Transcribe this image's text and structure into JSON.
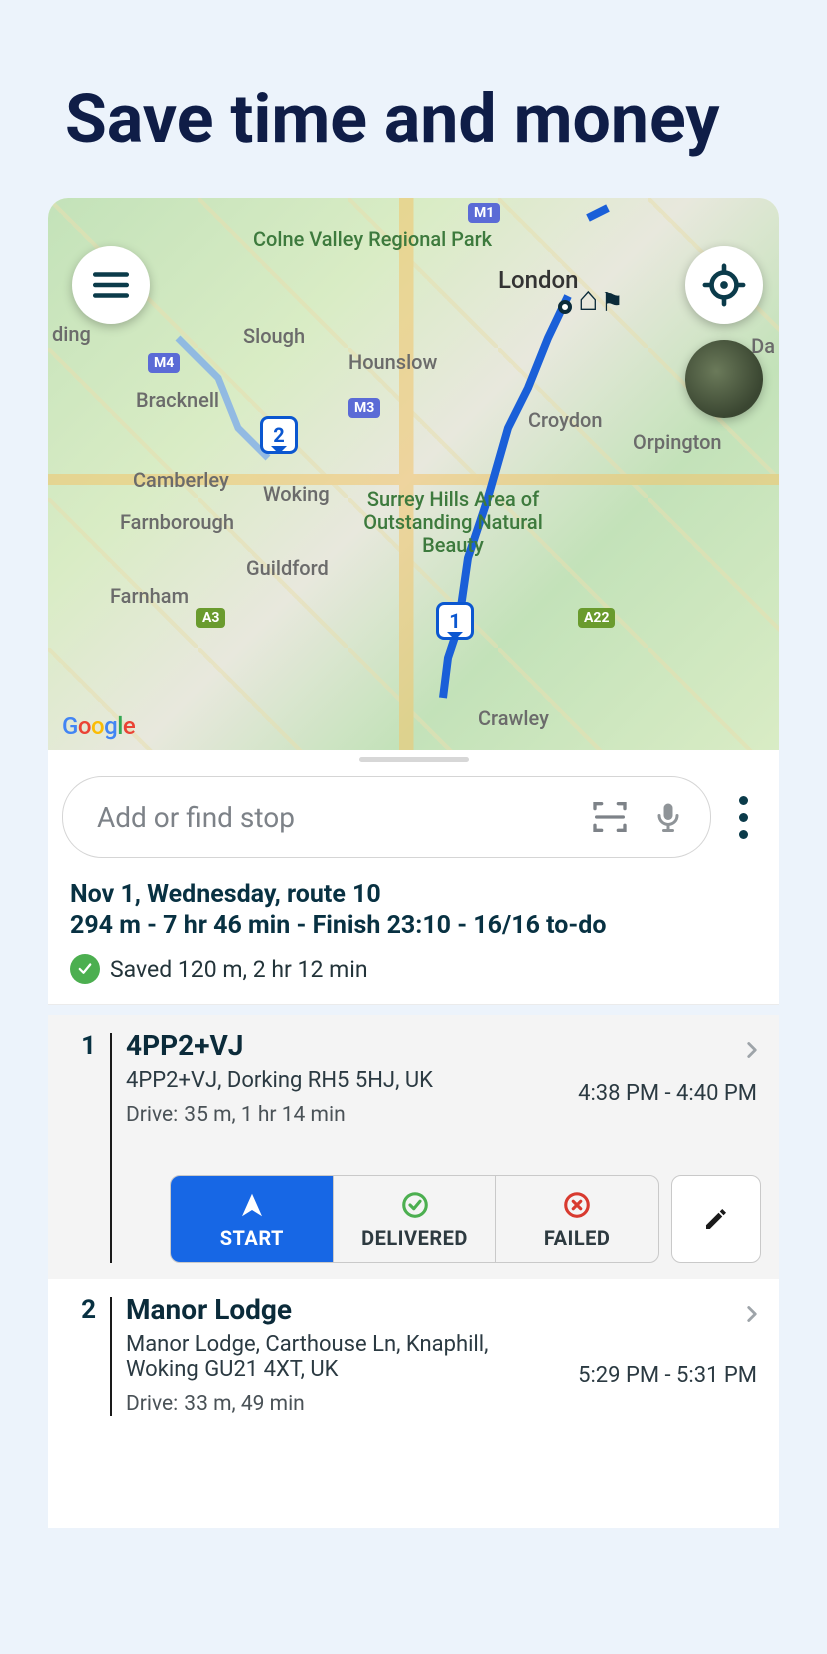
{
  "headline": "Save time and money",
  "map": {
    "menu_icon": "hamburger-icon",
    "locate_icon": "locate-icon",
    "satellite_icon": "satellite-thumb",
    "provider": "Google",
    "areas": {
      "colne": "Colne Valley Regional Park",
      "surrey": "Surrey Hills Area of Outstanding Natural Beauty"
    },
    "places": {
      "london": "London",
      "slough": "Slough",
      "hounslow": "Hounslow",
      "bracknell": "Bracknell",
      "woking": "Woking",
      "camberley": "Camberley",
      "farnborough": "Farnborough",
      "farnham": "Farnham",
      "guildford": "Guildford",
      "croydon": "Croydon",
      "orpington": "Orpington",
      "crawley": "Crawley",
      "ding": "ding",
      "da": "Da"
    },
    "roads": {
      "m1": "M1",
      "m3": "M3",
      "m4": "M4",
      "a3": "A3",
      "a22": "A22"
    },
    "pins": {
      "p1": "1",
      "p2": "2"
    }
  },
  "search": {
    "placeholder": "Add or find stop"
  },
  "summary": {
    "title": "Nov 1, Wednesday, route 10",
    "stats": "294 m - 7 hr 46 min - Finish 23:10 - 16/16 to-do",
    "saved": "Saved 120 m, 2 hr 12 min"
  },
  "stops": [
    {
      "num": "1",
      "title": "4PP2+VJ",
      "address": "4PP2+VJ, Dorking RH5 5HJ, UK",
      "drive_label": "Drive:",
      "drive": "35 m, 1 hr 14 min",
      "time": "4:38 PM - 4:40 PM"
    },
    {
      "num": "2",
      "title": "Manor Lodge",
      "address": "Manor Lodge, Carthouse Ln, Knaphill, Woking GU21 4XT, UK",
      "drive_label": "Drive:",
      "drive": "33 m, 49 min",
      "time": "5:29 PM - 5:31 PM"
    }
  ],
  "actions": {
    "start": "START",
    "delivered": "DELIVERED",
    "failed": "FAILED"
  }
}
